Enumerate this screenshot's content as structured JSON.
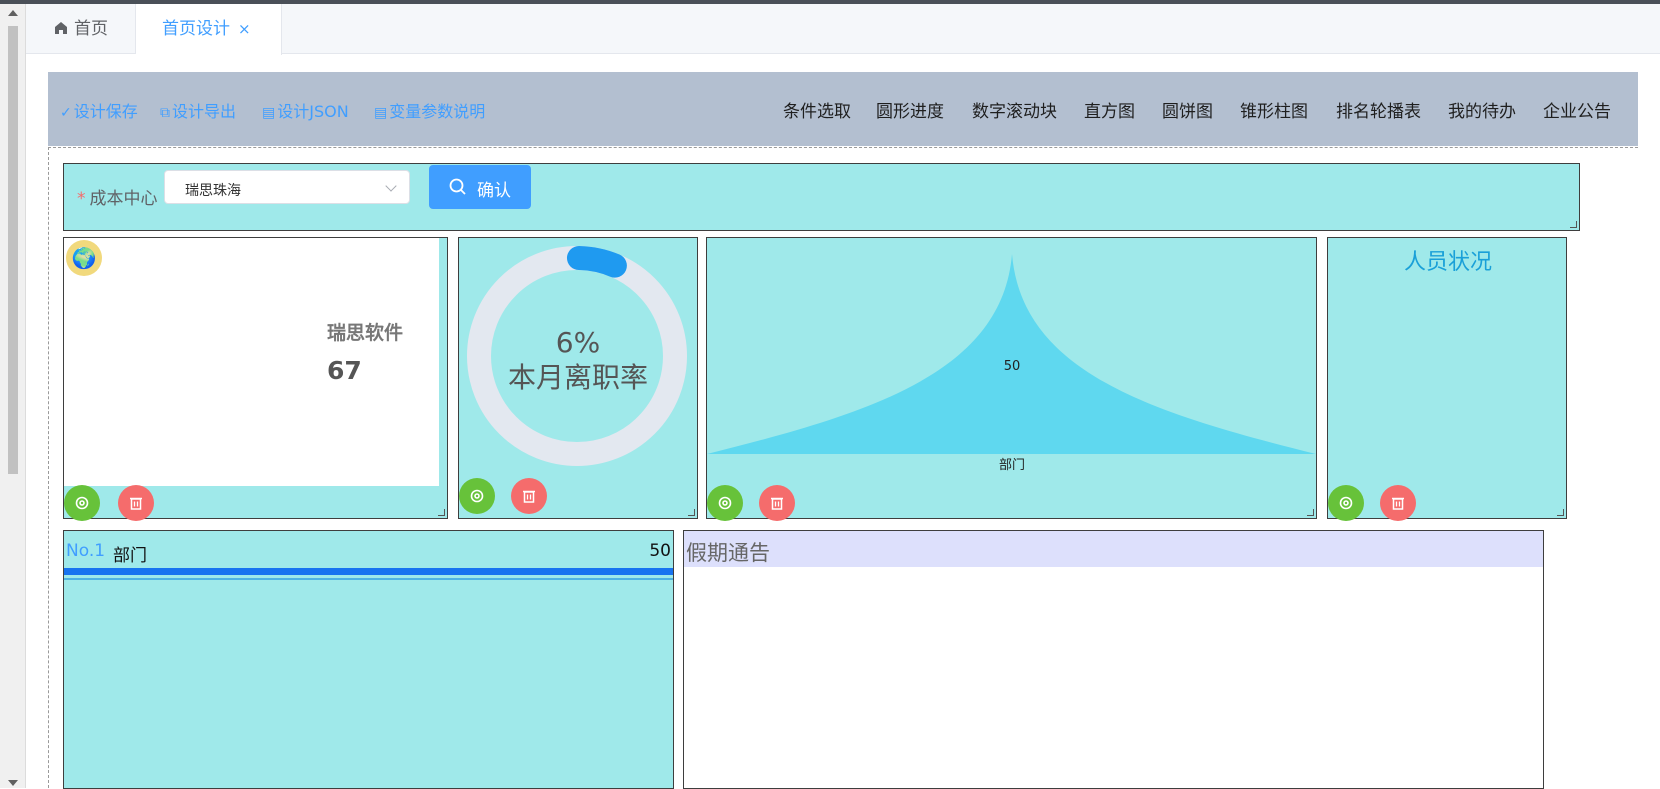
{
  "tabs": {
    "home_label": "首页",
    "active_label": "首页设计",
    "close_glyph": "×"
  },
  "toolbar": {
    "save": "设计保存",
    "export": "设计导出",
    "json": "设计JSON",
    "vars": "变量参数说明",
    "widgets": [
      "条件选取",
      "圆形进度",
      "数字滚动块",
      "直方图",
      "圆饼图",
      "锥形柱图",
      "排名轮播表",
      "我的待办",
      "企业公告"
    ]
  },
  "filter": {
    "required_mark": "*",
    "label": "成本中心",
    "select_value": "瑞思珠海",
    "confirm_label": "确认"
  },
  "counter": {
    "icon": "globe-icon",
    "company": "瑞思软件",
    "value": "67"
  },
  "ring": {
    "percent_text": "6%",
    "label": "本月离职率",
    "progress": 0.06
  },
  "cone_chart": {
    "chart_data": {
      "type": "bar",
      "categories": [
        "部门"
      ],
      "values": [
        50
      ],
      "value_label": "50"
    }
  },
  "people": {
    "title": "人员状况"
  },
  "ranking": {
    "items": [
      {
        "rank": "No.1",
        "name": "部门",
        "value": "50"
      }
    ]
  },
  "notice": {
    "title": "假期通告"
  },
  "colors": {
    "panel_bg": "#9fe9ea",
    "accent": "#409eff",
    "toolbar_bg": "#b3bfd0",
    "gear_btn": "#67c23a",
    "trash_btn": "#f56c6c",
    "cone_fill": "#5fd8ef",
    "notice_head": "#dde0fc"
  }
}
